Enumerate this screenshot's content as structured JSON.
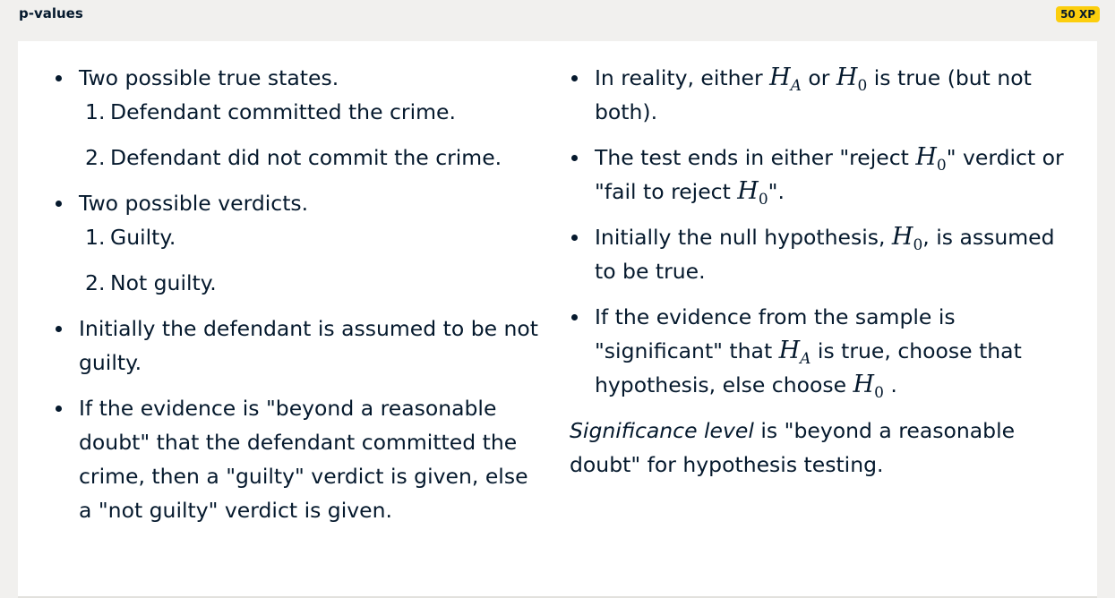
{
  "header": {
    "title": "p-values",
    "xp_badge": "50 XP"
  },
  "left": {
    "states_heading": "Two possible true states.",
    "states": [
      {
        "marker": "1.",
        "text": "Defendant committed the crime."
      },
      {
        "marker": "2.",
        "text": "Defendant did not commit the crime."
      }
    ],
    "verdicts_heading": "Two possible verdicts.",
    "verdicts": [
      {
        "marker": "1.",
        "text": "Guilty."
      },
      {
        "marker": "2.",
        "text": "Not guilty."
      }
    ],
    "assumed": "Initially the defendant is assumed to be not guilty.",
    "evidence": "If the evidence is \"beyond a reasonable doubt\" that the defendant committed the crime, then a \"guilty\" verdict is given, else a \"not guilty\" verdict is given."
  },
  "right": {
    "h": "H",
    "sub_a": "A",
    "sub_0": "0",
    "b1_part1": "In reality, either ",
    "b1_part2": " or ",
    "b1_part3": " is true (but not both).",
    "b2_part1": "The test ends in either \"reject ",
    "b2_part2": "\" verdict or \"fail to reject ",
    "b2_part3": "\".",
    "b3_part1": "Initially the null hypothesis, ",
    "b3_part2": ", is assumed to be true.",
    "b4_part1": "If the evidence from the sample is \"significant\" that ",
    "b4_part2": " is true, choose that hypothesis, else choose ",
    "b4_part3": " .",
    "sig_emph": "Significance level",
    "sig_rest": " is \"beyond a reasonable doubt\" for hypothesis testing."
  }
}
